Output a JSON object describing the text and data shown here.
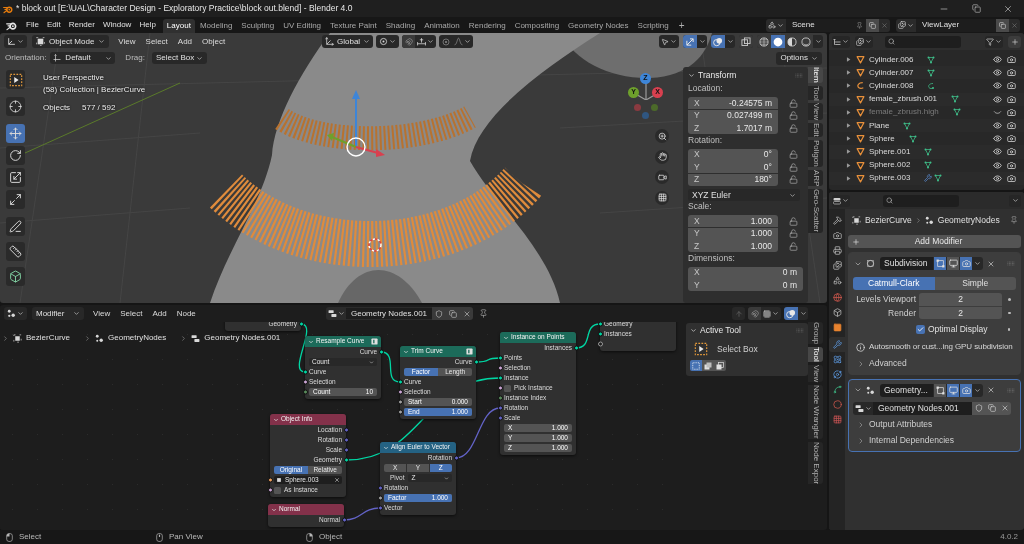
{
  "window": {
    "title": "* block out [E:\\UAL\\Character Design - Exploratory Practice\\block out.blend] - Blender 4.0"
  },
  "menu": [
    "File",
    "Edit",
    "Render",
    "Window",
    "Help"
  ],
  "workspaces": [
    {
      "label": "Layout",
      "selected": true
    },
    {
      "label": "Modeling",
      "selected": false
    },
    {
      "label": "Sculpting",
      "selected": false
    },
    {
      "label": "UV Editing",
      "selected": false
    },
    {
      "label": "Texture Paint",
      "selected": false
    },
    {
      "label": "Shading",
      "selected": false
    },
    {
      "label": "Animation",
      "selected": false
    },
    {
      "label": "Rendering",
      "selected": false
    },
    {
      "label": "Compositing",
      "selected": false
    },
    {
      "label": "Geometry Nodes",
      "selected": false
    },
    {
      "label": "Scripting",
      "selected": false
    }
  ],
  "add_workspace": "+",
  "scene": {
    "value": "Scene"
  },
  "view_layer": {
    "value": "ViewLayer"
  },
  "viewport": {
    "mode": "Object Mode",
    "menus": [
      "View",
      "Select",
      "Add",
      "Object"
    ],
    "orientation": "Global",
    "header_toggles": [
      {
        "kind": "gizmo",
        "on": true
      },
      {
        "kind": "overlay",
        "on": true
      },
      {
        "kind": "xray",
        "on": false
      }
    ],
    "shading": [
      {
        "kind": "wireframe",
        "selected": false
      },
      {
        "kind": "solid",
        "selected": true
      },
      {
        "kind": "material",
        "selected": false
      },
      {
        "kind": "rendered",
        "selected": false
      }
    ],
    "tool_settings": {
      "orientation_label": "Orientation:",
      "orientation": "Default",
      "drag_label": "Drag:",
      "drag": "Select Box",
      "options": "Options"
    },
    "tools": [
      {
        "kind": "select_box",
        "selected": false
      },
      {
        "kind": "cursor",
        "selected": false
      },
      {
        "kind": "move",
        "selected": true
      },
      {
        "kind": "rotate",
        "selected": false
      },
      {
        "kind": "scale",
        "selected": false
      },
      {
        "kind": "transform",
        "selected": false
      },
      {
        "kind": "annotate",
        "selected": false
      },
      {
        "kind": "measure",
        "selected": false
      },
      {
        "kind": "add_cube",
        "selected": false
      }
    ],
    "overlay_text": [
      "User Perspective",
      "(58) Collection | BezierCurve"
    ],
    "statistics": [
      {
        "label": "Objects",
        "value": "577 / 592"
      }
    ],
    "navigation_gizmo": {
      "axes": [
        {
          "label": "Z",
          "color": "#3d85d8"
        },
        {
          "label": "Y",
          "color": "#6ea02c"
        },
        {
          "label": "X",
          "color": "#d8404f"
        }
      ]
    },
    "sidebar": {
      "panel": "Transform",
      "groups": [
        {
          "label": "Location:",
          "fields": [
            {
              "axis": "X",
              "value": "-0.24575 m",
              "locked": false
            },
            {
              "axis": "Y",
              "value": "0.027499 m",
              "locked": false
            },
            {
              "axis": "Z",
              "value": "1.7017 m",
              "locked": false
            }
          ]
        },
        {
          "label": "Rotation:",
          "fields": [
            {
              "axis": "X",
              "value": "0°",
              "locked": false
            },
            {
              "axis": "Y",
              "value": "0°",
              "locked": false
            },
            {
              "axis": "Z",
              "value": "180°",
              "locked": false
            }
          ],
          "mode": "XYZ Euler"
        },
        {
          "label": "Scale:",
          "fields": [
            {
              "axis": "X",
              "value": "1.000",
              "locked": false
            },
            {
              "axis": "Y",
              "value": "1.000",
              "locked": false
            },
            {
              "axis": "Z",
              "value": "1.000",
              "locked": false
            }
          ]
        },
        {
          "label": "Dimensions:",
          "fields": [
            {
              "axis": "X",
              "value": "0 m"
            },
            {
              "axis": "Y",
              "value": "0 m"
            }
          ]
        }
      ]
    },
    "tabs": [
      {
        "label": "Item",
        "selected": true
      },
      {
        "label": "Tool",
        "selected": false
      },
      {
        "label": "View",
        "selected": false
      },
      {
        "label": "Edit",
        "selected": false
      },
      {
        "label": "Poligon",
        "selected": false
      },
      {
        "label": "ARP",
        "selected": false
      },
      {
        "label": "Geo-Scatter",
        "selected": false
      }
    ]
  },
  "outliner": {
    "rows": [
      {
        "name": "Cylinder.006",
        "kind": "mesh",
        "badges": [
          {
            "kind": "mesh_data"
          }
        ],
        "visible": true
      },
      {
        "name": "Cylinder.007",
        "kind": "mesh",
        "badges": [
          {
            "kind": "mesh_data"
          }
        ],
        "visible": true
      },
      {
        "name": "Cylinder.008",
        "kind": "curve",
        "badges": [
          {
            "kind": "curve_data"
          }
        ],
        "visible": true
      },
      {
        "name": "female_zbrush.001",
        "kind": "mesh",
        "badges": [
          {
            "kind": "mesh_data"
          }
        ],
        "visible": true
      },
      {
        "name": "female_zbrush.high",
        "kind": "mesh",
        "badges": [
          {
            "kind": "mesh_data"
          }
        ],
        "visible": false
      },
      {
        "name": "Plane",
        "kind": "mesh",
        "badges": [
          {
            "kind": "mesh_data"
          }
        ],
        "visible": true
      },
      {
        "name": "Sphere",
        "kind": "mesh",
        "badges": [
          {
            "kind": "mesh_data"
          }
        ],
        "visible": true
      },
      {
        "name": "Sphere.001",
        "kind": "mesh",
        "badges": [
          {
            "kind": "mesh_data"
          }
        ],
        "visible": true
      },
      {
        "name": "Sphere.002",
        "kind": "mesh",
        "badges": [
          {
            "kind": "mesh_data"
          }
        ],
        "visible": true
      },
      {
        "name": "Sphere.003",
        "kind": "mesh",
        "badges": [
          {
            "kind": "modifier"
          },
          {
            "kind": "mesh_data"
          }
        ],
        "visible": true
      }
    ]
  },
  "properties": {
    "tabs": [
      {
        "kind": "tool",
        "selected": false
      },
      {
        "kind": "render",
        "selected": false
      },
      {
        "kind": "output",
        "selected": false
      },
      {
        "kind": "view_layer",
        "selected": false
      },
      {
        "kind": "scene",
        "selected": false
      },
      {
        "kind": "world",
        "selected": false
      },
      {
        "kind": "collection",
        "selected": false
      },
      {
        "kind": "object",
        "selected": false
      },
      {
        "kind": "modifiers",
        "selected": true
      },
      {
        "kind": "particles",
        "selected": false
      },
      {
        "kind": "physics",
        "selected": false
      },
      {
        "kind": "data",
        "selected": false
      },
      {
        "kind": "material",
        "selected": false
      },
      {
        "kind": "texture",
        "selected": false
      }
    ],
    "breadcrumb": [
      "BezierCurve",
      "GeometryNodes"
    ],
    "add_modifier": "Add Modifier",
    "modifiers": [
      {
        "kind": "subdivision",
        "name": "Subdivision",
        "expanded": true,
        "active": false,
        "toggles": [
          {
            "kind": "edit_mode",
            "on": true
          },
          {
            "kind": "viewport",
            "on": false
          },
          {
            "kind": "render",
            "on": true
          }
        ],
        "method": [
          {
            "label": "Catmull-Clark",
            "selected": true
          },
          {
            "label": "Simple",
            "selected": false
          }
        ],
        "fields": [
          {
            "label": "Levels Viewport",
            "value": "2"
          },
          {
            "label": "Render",
            "value": "2"
          }
        ],
        "checkbox": {
          "label": "Optimal Display",
          "checked": true
        },
        "info": "Autosmooth or cust...ing GPU subdivision",
        "subpanels": [
          {
            "label": "Advanced",
            "expanded": false
          }
        ]
      },
      {
        "kind": "geometry_nodes",
        "name": "Geometry...",
        "expanded": true,
        "active": true,
        "toggles": [
          {
            "kind": "edit_mode",
            "on": false
          },
          {
            "kind": "viewport",
            "on": true
          },
          {
            "kind": "render",
            "on": true
          }
        ],
        "node_group": "Geometry Nodes.001",
        "subpanels": [
          {
            "label": "Output Attributes",
            "expanded": false
          },
          {
            "label": "Internal Dependencies",
            "expanded": false
          }
        ]
      }
    ]
  },
  "node_editor": {
    "context": "Modifier",
    "menus": [
      "View",
      "Select",
      "Add",
      "Node"
    ],
    "node_group": "Geometry Nodes.001",
    "breadcrumb": [
      "BezierCurve",
      "GeometryNodes",
      "Geometry Nodes.001"
    ],
    "nodes": [
      {
        "kind": "group",
        "rows": [
          {
            "kind": "output",
            "label": "Geometry",
            "socket": {
              "kind": "geometry"
            }
          }
        ]
      },
      {
        "kind": "geometry",
        "title": "Resample Curve",
        "header_icon": true,
        "rows": [
          {
            "kind": "output",
            "label": "Curve",
            "socket": {
              "kind": "geometry"
            }
          },
          {
            "kind": "dropdown",
            "value": "Count"
          },
          {
            "kind": "input",
            "label": "Curve",
            "socket": {
              "kind": "geometry"
            }
          },
          {
            "kind": "input",
            "label": "Selection",
            "socket": {
              "kind": "boolean"
            }
          },
          {
            "kind": "field",
            "label": "Count",
            "value": "10",
            "socket": {
              "kind": "integer"
            }
          }
        ]
      },
      {
        "kind": "geometry",
        "title": "Trim Curve",
        "header_icon": true,
        "rows": [
          {
            "kind": "output",
            "label": "Curve",
            "socket": {
              "kind": "geometry"
            }
          },
          {
            "kind": "toggle",
            "options": [
              {
                "label": "Factor",
                "selected": true
              },
              {
                "label": "Length",
                "selected": false
              }
            ]
          },
          {
            "kind": "input",
            "label": "Curve",
            "socket": {
              "kind": "geometry"
            }
          },
          {
            "kind": "input",
            "label": "Selection",
            "socket": {
              "kind": "boolean"
            }
          },
          {
            "kind": "field",
            "label": "Start",
            "value": "0.000",
            "socket": {
              "kind": "float"
            }
          },
          {
            "kind": "field",
            "label": "End",
            "value": "1.000",
            "level": 1,
            "socket": {
              "kind": "float"
            }
          }
        ]
      },
      {
        "kind": "geometry",
        "title": "Instance on Points",
        "rows": [
          {
            "kind": "output",
            "label": "Instances",
            "socket": {
              "kind": "geometry"
            }
          },
          {
            "kind": "input",
            "label": "Points",
            "socket": {
              "kind": "geometry"
            }
          },
          {
            "kind": "input",
            "label": "Selection",
            "socket": {
              "kind": "boolean"
            }
          },
          {
            "kind": "input",
            "label": "Instance",
            "socket": {
              "kind": "geometry"
            }
          },
          {
            "kind": "checkbox",
            "label": "Pick Instance",
            "checked": false,
            "socket": {
              "kind": "boolean"
            }
          },
          {
            "kind": "input",
            "label": "Instance Index",
            "socket": {
              "kind": "integer"
            }
          },
          {
            "kind": "input",
            "label": "Rotation",
            "socket": {
              "kind": "vector"
            }
          },
          {
            "kind": "input",
            "label": "Scale",
            "socket": {
              "kind": "vector"
            }
          },
          {
            "kind": "field",
            "label": "X",
            "value": "1.000"
          },
          {
            "kind": "field",
            "label": "Y",
            "value": "1.000"
          },
          {
            "kind": "field",
            "label": "Z",
            "value": "1.000"
          }
        ]
      },
      {
        "kind": "group",
        "rows": [
          {
            "kind": "input",
            "label": "Geometry",
            "socket": {
              "kind": "geometry"
            }
          },
          {
            "kind": "input",
            "label": "Instances",
            "socket": {
              "kind": "geometry"
            }
          },
          {
            "kind": "input",
            "socket": {
              "kind": "virtual"
            }
          }
        ]
      },
      {
        "kind": "input",
        "title": "Object Info",
        "rows": [
          {
            "kind": "output",
            "label": "Location",
            "socket": {
              "kind": "vector"
            }
          },
          {
            "kind": "output",
            "label": "Rotation",
            "socket": {
              "kind": "vector"
            }
          },
          {
            "kind": "output",
            "label": "Scale",
            "socket": {
              "kind": "vector"
            }
          },
          {
            "kind": "output",
            "label": "Geometry",
            "socket": {
              "kind": "geometry"
            }
          },
          {
            "kind": "toggle",
            "options": [
              {
                "label": "Original",
                "selected": true
              },
              {
                "label": "Relative",
                "selected": false
              }
            ]
          },
          {
            "kind": "object",
            "value": "Sphere.003",
            "socket": {
              "kind": "object"
            }
          },
          {
            "kind": "checkbox",
            "label": "As Instance",
            "checked": false,
            "socket": {
              "kind": "boolean"
            }
          }
        ]
      },
      {
        "kind": "converter",
        "title": "Align Euler to Vector",
        "rows": [
          {
            "kind": "output",
            "label": "Rotation",
            "socket": {
              "kind": "vector"
            }
          },
          {
            "kind": "toggle",
            "options": [
              {
                "label": "X",
                "selected": false
              },
              {
                "label": "Y",
                "selected": false
              },
              {
                "label": "Z",
                "selected": true
              }
            ]
          },
          {
            "kind": "dropdown",
            "label": "Pivot",
            "value": "Z"
          },
          {
            "kind": "input",
            "label": "Rotation",
            "socket": {
              "kind": "vector"
            }
          },
          {
            "kind": "field",
            "label": "Factor",
            "value": "1.000",
            "level": 1,
            "socket": {
              "kind": "float"
            }
          },
          {
            "kind": "input",
            "label": "Vector",
            "socket": {
              "kind": "vector"
            }
          }
        ]
      },
      {
        "kind": "input",
        "title": "Normal",
        "rows": [
          {
            "kind": "output",
            "label": "Normal",
            "socket": {
              "kind": "vector"
            }
          }
        ]
      }
    ],
    "sidebar": {
      "panel": "Active Tool",
      "tool": "Select Box",
      "modes": [
        {
          "kind": "set",
          "selected": true
        },
        {
          "kind": "extend",
          "selected": false
        },
        {
          "kind": "subtract",
          "selected": false
        }
      ]
    },
    "tabs": [
      {
        "label": "Group",
        "selected": false
      },
      {
        "label": "Tool",
        "selected": true
      },
      {
        "label": "View",
        "selected": false
      },
      {
        "label": "Node Wrangler",
        "selected": false
      },
      {
        "label": "Node Expor",
        "selected": false
      }
    ]
  },
  "status_bar": {
    "hints": [
      {
        "kind": "left",
        "label": "Select"
      },
      {
        "kind": "middle",
        "label": "Pan View"
      },
      {
        "kind": "right",
        "label": "Object"
      }
    ],
    "version": "4.0.2"
  }
}
